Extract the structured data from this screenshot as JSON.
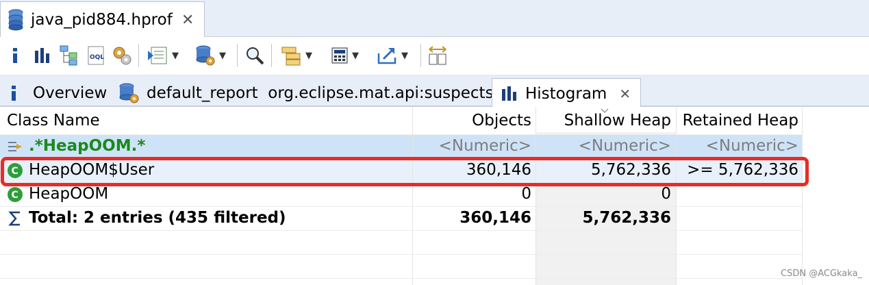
{
  "editor": {
    "tab_title": "java_pid884.hprof"
  },
  "toolbar": {
    "buttons": [
      {
        "name": "overview-info-icon"
      },
      {
        "name": "histogram-icon"
      },
      {
        "name": "dominator-tree-icon"
      },
      {
        "name": "oql-icon"
      },
      {
        "name": "thread-overview-icon"
      },
      {
        "name": "run-report-icon"
      },
      {
        "name": "query-browser-icon"
      },
      {
        "name": "search-icon"
      },
      {
        "name": "group-icon"
      },
      {
        "name": "calculator-icon"
      },
      {
        "name": "export-icon"
      },
      {
        "name": "compare-icon"
      }
    ]
  },
  "subtabs": {
    "overview": "Overview",
    "default_report": "default_report  org.eclipse.mat.api:suspects",
    "histogram": "Histogram"
  },
  "table": {
    "headers": {
      "class_name": "Class Name",
      "objects": "Objects",
      "shallow_heap": "Shallow Heap",
      "retained_heap": "Retained Heap"
    },
    "filter": {
      "class_name": ".*HeapOOM.*",
      "objects": "<Numeric>",
      "shallow_heap": "<Numeric>",
      "retained_heap": "<Numeric>"
    },
    "rows": [
      {
        "class_name": "HeapOOM$User",
        "objects": "360,146",
        "shallow_heap": "5,762,336",
        "retained_heap": ">= 5,762,336"
      },
      {
        "class_name": "HeapOOM",
        "objects": "0",
        "shallow_heap": "0",
        "retained_heap": ""
      }
    ],
    "total": {
      "label": "Total: 2 entries (435 filtered)",
      "objects": "360,146",
      "shallow_heap": "5,762,336"
    }
  },
  "watermark": "CSDN @ACGkaka_",
  "colors": {
    "highlight": "#ea2b23",
    "filter_text": "#1a8a1a",
    "class_icon": "#2e9e3a"
  }
}
